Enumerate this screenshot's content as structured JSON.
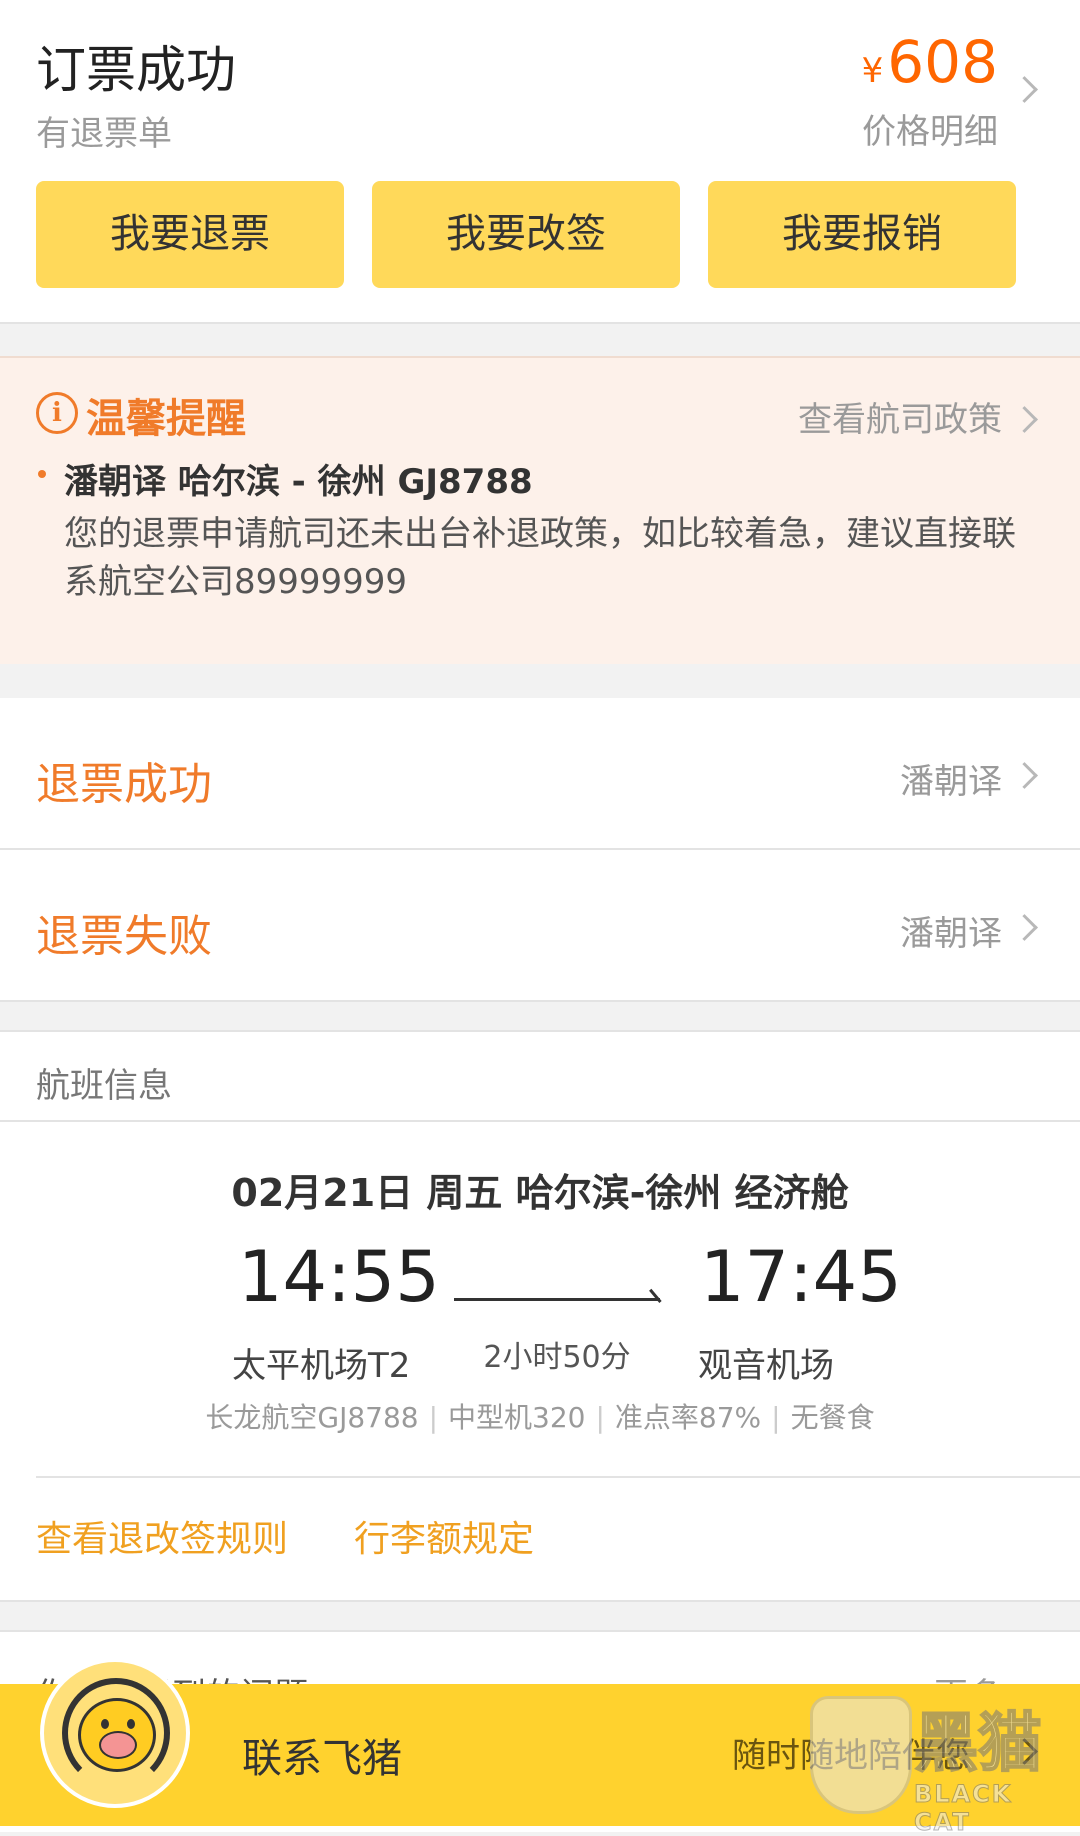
{
  "header": {
    "title": "订票成功",
    "subtitle": "有退票单",
    "price_currency": "¥",
    "price_value": "608",
    "price_detail": "价格明细",
    "actions": [
      {
        "label": "我要退票"
      },
      {
        "label": "我要改签"
      },
      {
        "label": "我要报销"
      }
    ]
  },
  "reminder": {
    "title": "温馨提醒",
    "link": "查看航司政策",
    "passenger_line": "潘朝译 哈尔滨 - 徐州 GJ8788",
    "message": "您的退票申请航司还未出台补退政策，如比较着急，建议直接联系航空公司89999999"
  },
  "statuses": [
    {
      "title": "退票成功",
      "name": "潘朝译"
    },
    {
      "title": "退票失败",
      "name": "潘朝译"
    }
  ],
  "flight": {
    "section_label": "航班信息",
    "date_route": "02月21日 周五 哈尔滨-徐州 经济舱",
    "depart_time": "14:55",
    "arrive_time": "17:45",
    "duration": "2小时50分",
    "depart_airport": "太平机场T2",
    "arrive_airport": "观音机场",
    "meta": [
      "长龙航空GJ8788",
      "中型机320",
      "准点率87%",
      "无餐食"
    ],
    "links": [
      "查看退改签规则",
      "行李额规定"
    ]
  },
  "issues": {
    "title": "你可能遇到的问题",
    "more": "更多"
  },
  "bottom_bar": {
    "contact": "联系飞猪",
    "slogan": "随时随地陪伴您"
  },
  "watermark": {
    "text": "黑猫",
    "sub": "BLACK CAT"
  },
  "colors": {
    "accent_orange": "#f07b2a",
    "price_orange": "#ff6600",
    "button_yellow": "#ffd95a",
    "bar_yellow": "#ffd22e",
    "reminder_bg": "#fdf1ea",
    "link_gold": "#f0a020"
  }
}
